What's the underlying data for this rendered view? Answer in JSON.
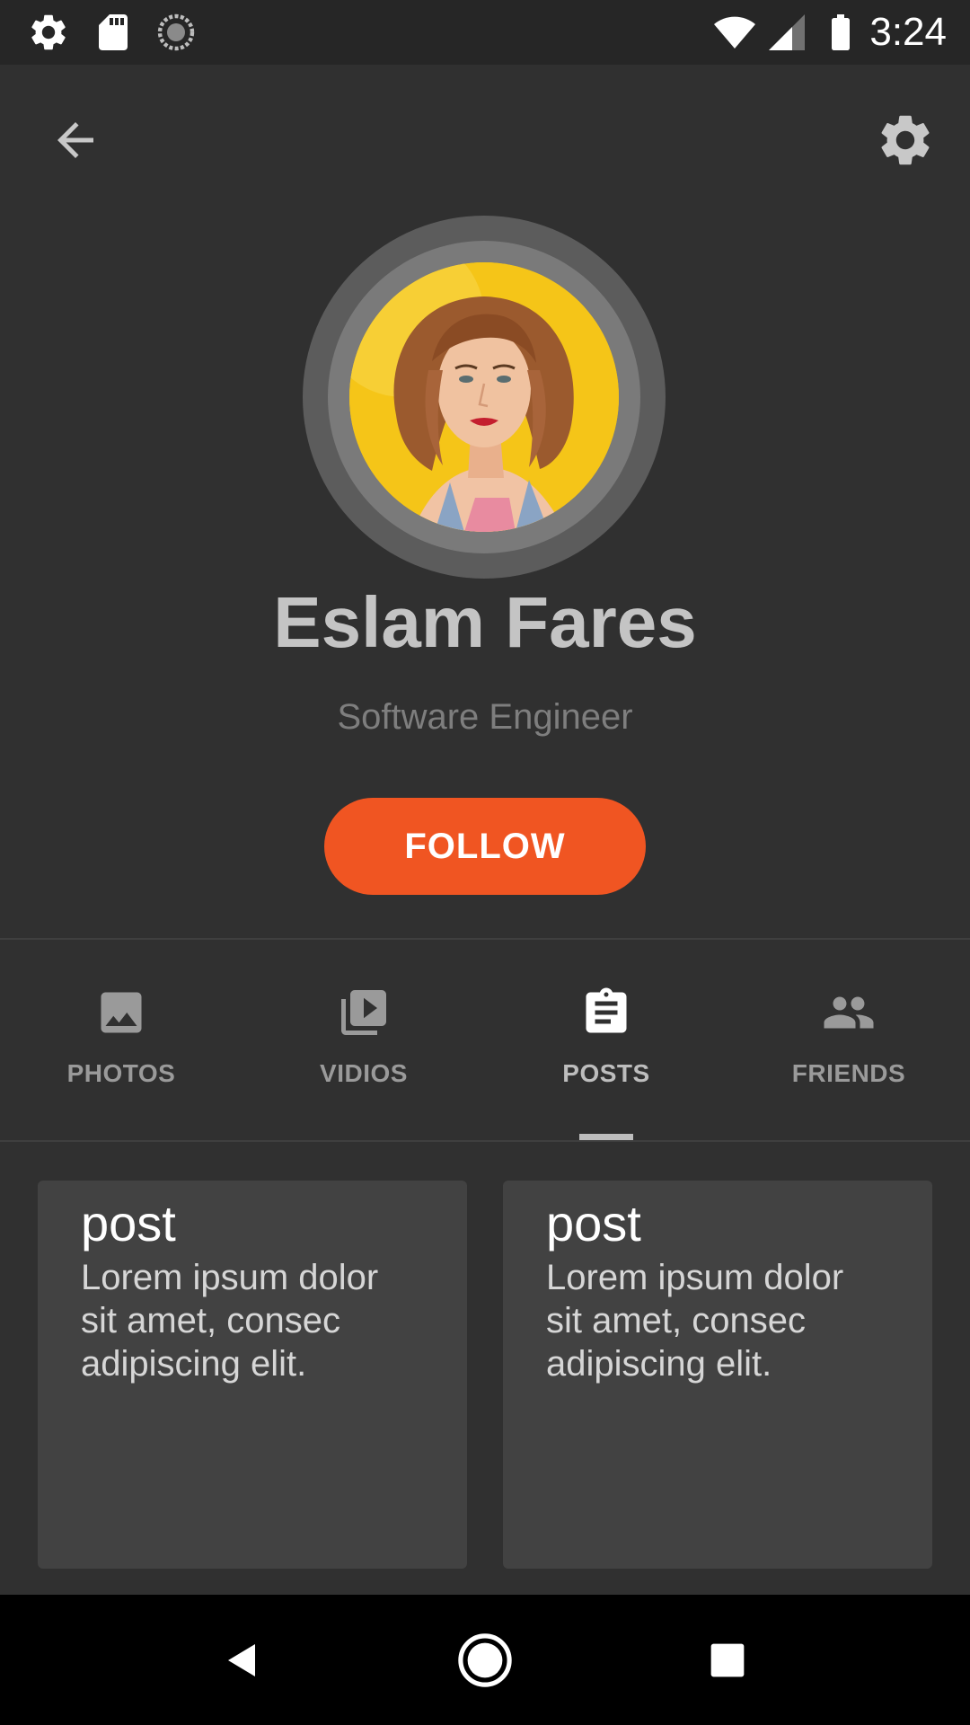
{
  "status_bar": {
    "time": "3:24",
    "left_icons": [
      "gear-icon",
      "sd-card-icon",
      "sync-icon"
    ],
    "right_icons": [
      "wifi-icon",
      "signal-icon",
      "battery-icon"
    ]
  },
  "app_bar": {
    "back_icon": "arrow-left-icon",
    "settings_icon": "gear-icon"
  },
  "profile": {
    "name": "Eslam Fares",
    "role": "Software Engineer",
    "follow_label": "FOLLOW",
    "avatar_background": "#f5c518"
  },
  "tabs": [
    {
      "label": "PHOTOS",
      "icon": "image-icon",
      "active": false
    },
    {
      "label": "VIDIOS",
      "icon": "video-library-icon",
      "active": false
    },
    {
      "label": "POSTS",
      "icon": "clipboard-icon",
      "active": true
    },
    {
      "label": "FRIENDS",
      "icon": "people-icon",
      "active": false
    }
  ],
  "posts": [
    {
      "title": "post",
      "body": "Lorem ipsum dolor sit amet, consec adipiscing elit."
    },
    {
      "title": "post",
      "body": "Lorem ipsum dolor sit amet, consec adipiscing elit."
    }
  ],
  "nav_bar": {
    "buttons": [
      "back-triangle-icon",
      "home-circle-icon",
      "recents-square-icon"
    ]
  },
  "colors": {
    "background": "#303030",
    "accent": "#f05522",
    "card": "#424242",
    "status_bar": "#262626"
  }
}
